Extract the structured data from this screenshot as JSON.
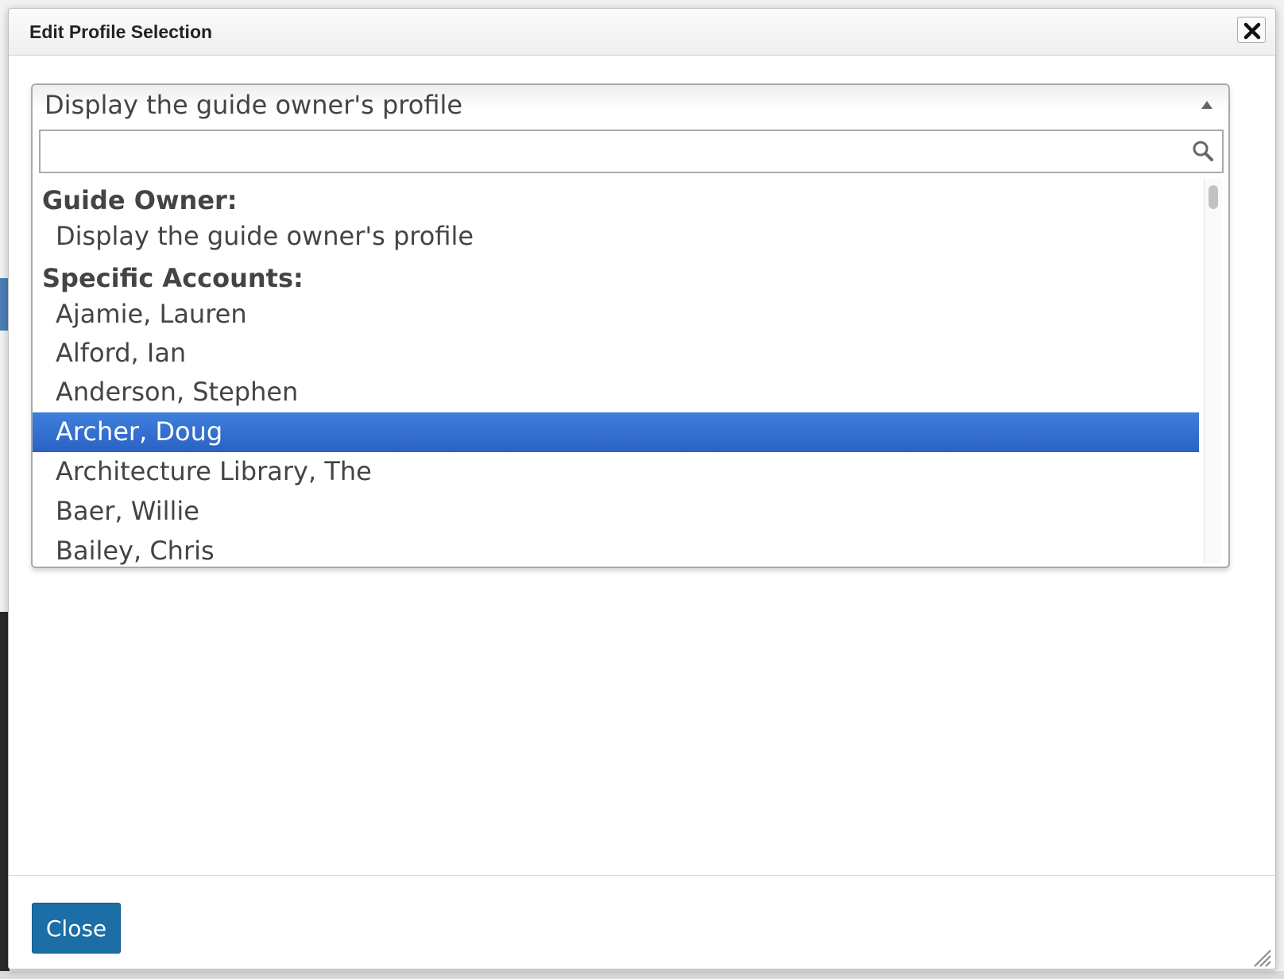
{
  "dialog": {
    "title": "Edit Profile Selection",
    "close_button_label": "Close"
  },
  "select": {
    "current_value": "Display the guide owner's profile",
    "search_placeholder": "",
    "search_value": "",
    "groups": [
      {
        "label": "Guide Owner:",
        "options": [
          "Display the guide owner's profile"
        ]
      },
      {
        "label": "Specific Accounts:",
        "options": [
          "Ajamie, Lauren",
          "Alford, Ian",
          "Anderson, Stephen",
          "Archer, Doug",
          "Architecture Library, The",
          "Baer, Willie",
          "Bailey, Chris"
        ]
      }
    ],
    "highlighted_option": "Archer, Doug"
  },
  "icons": {
    "close": "close-icon",
    "search": "search-icon",
    "dropdown_arrow": "chevron-up-icon",
    "resize": "resize-grip-icon"
  },
  "colors": {
    "highlight": "#3672d2",
    "primary_button": "#1b6ea6"
  }
}
